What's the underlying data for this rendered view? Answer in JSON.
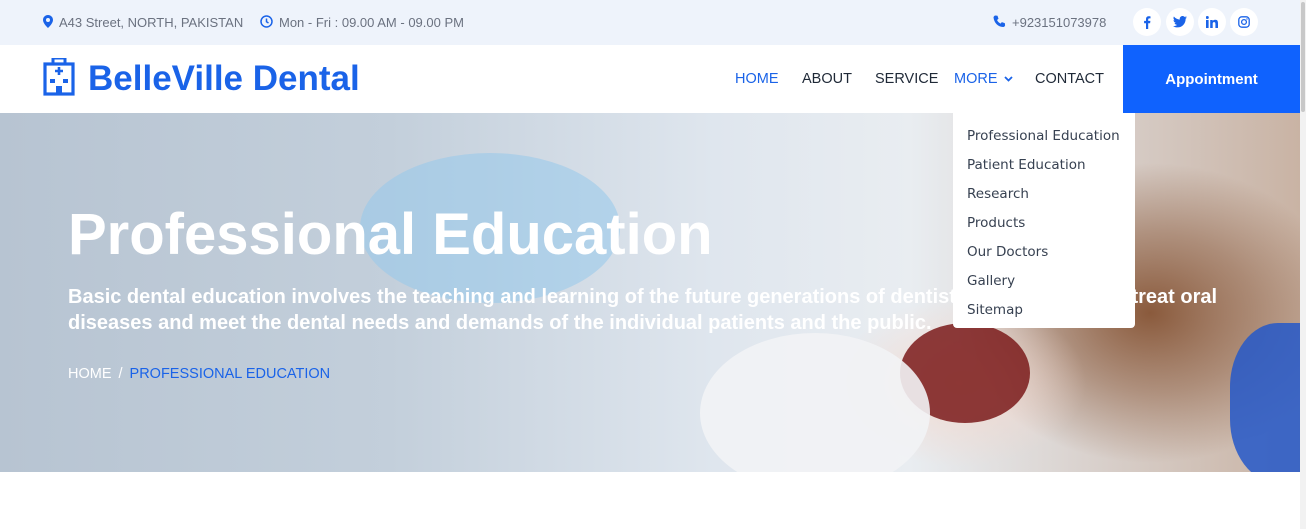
{
  "topbar": {
    "address": "A43 Street, NORTH, PAKISTAN",
    "hours": "Mon - Fri : 09.00 AM - 09.00 PM",
    "phone": "+923151073978",
    "social_icons": [
      "facebook-icon",
      "twitter-icon",
      "linkedin-icon",
      "instagram-icon"
    ],
    "social_glyphs": [
      "f",
      "t",
      "in",
      "ig"
    ]
  },
  "brand": {
    "name": "BelleVille Dental",
    "icon": "hospital-icon"
  },
  "nav": {
    "home": "HOME",
    "about": "ABOUT",
    "service": "SERVICE",
    "more": "MORE",
    "contact": "CONTACT",
    "appointment": "Appointment"
  },
  "dropdown": {
    "items": [
      "Professional Education",
      "Patient Education",
      "Research",
      "Products",
      "Our Doctors",
      "Gallery",
      "Sitemap"
    ]
  },
  "hero": {
    "title": "Professional Education",
    "description": "Basic dental education involves the teaching and learning of the future generations of dentists to diagnose and treat oral diseases and meet the dental needs and demands of the individual patients and the public.",
    "breadcrumb_home": "HOME",
    "breadcrumb_sep": "/",
    "breadcrumb_current": "PROFESSIONAL EDUCATION"
  },
  "colors": {
    "accent": "#1a63e8",
    "button": "#0f62fe",
    "topbar_bg": "#eef3fb"
  }
}
